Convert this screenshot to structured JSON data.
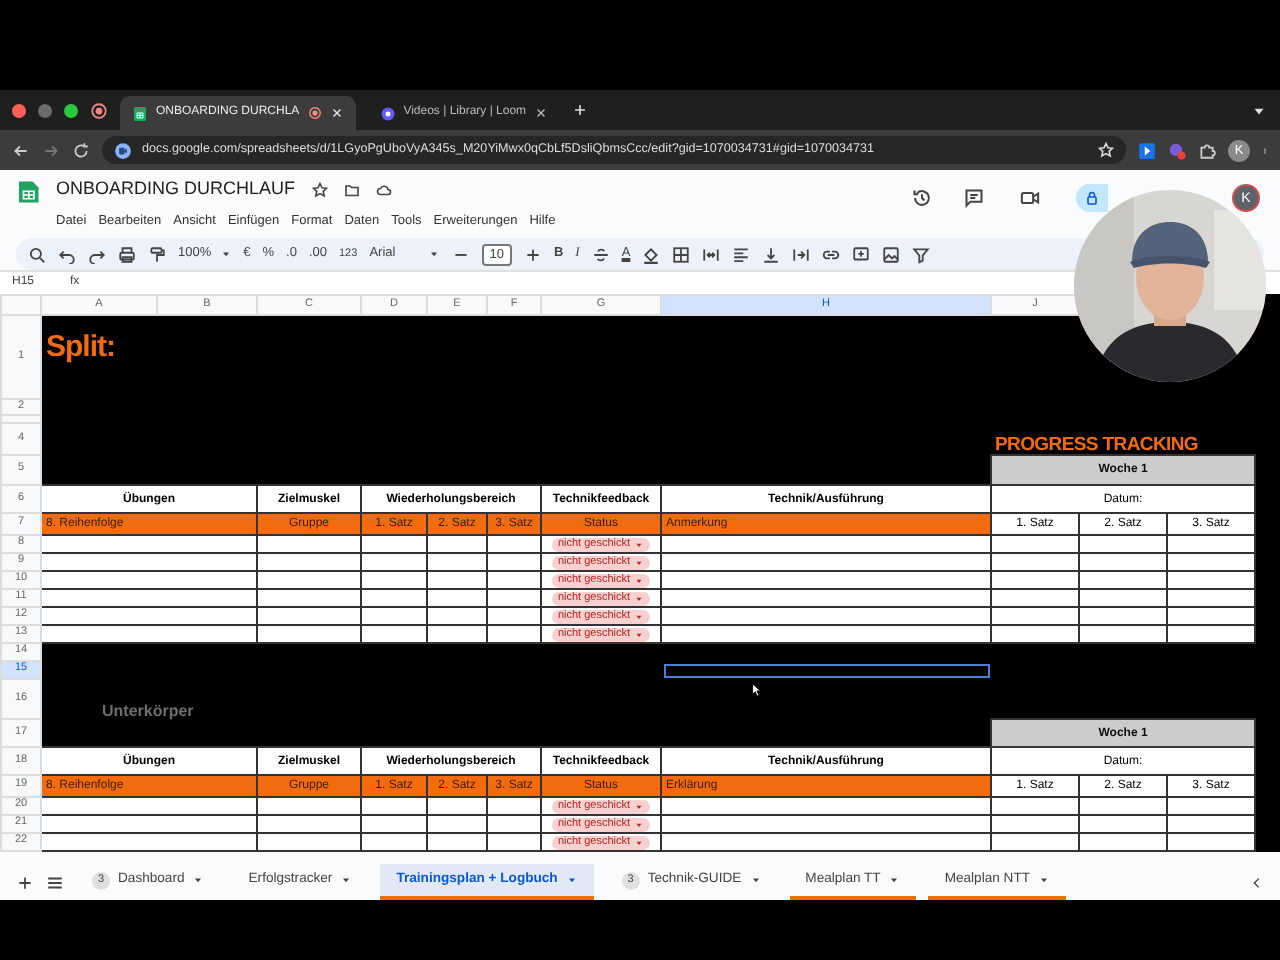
{
  "browser": {
    "tabs": [
      {
        "title": "ONBOARDING DURCHLA",
        "selected": true
      },
      {
        "title": "Videos | Library | Loom",
        "selected": false
      }
    ],
    "url": "docs.google.com/spreadsheets/d/1LGyoPgUboVyA345s_M20YiMwx0qCbLf5DsliQbmsCcc/edit?gid=1070034731#gid=1070034731",
    "profile_initial": "K"
  },
  "sheets": {
    "title": "ONBOARDING DURCHLAUF",
    "menu": [
      "Datei",
      "Bearbeiten",
      "Ansicht",
      "Einfügen",
      "Format",
      "Daten",
      "Tools",
      "Erweiterungen",
      "Hilfe"
    ],
    "avatar_initial": "K",
    "toolbar": {
      "zoom": "100%",
      "currency": "€",
      "percent": "%",
      "decrease_decimals": ".0",
      "increase_decimals": ".00",
      "number_format": "123",
      "font": "Arial",
      "font_size": "10",
      "bold": "B",
      "italic": "I",
      "text_color": "A"
    },
    "name_box": "H15",
    "formula_label": "fx"
  },
  "grid": {
    "columns": [
      {
        "letter": "A",
        "selected": false
      },
      {
        "letter": "B",
        "selected": false
      },
      {
        "letter": "C",
        "selected": false
      },
      {
        "letter": "D",
        "selected": false
      },
      {
        "letter": "E",
        "selected": false
      },
      {
        "letter": "F",
        "selected": false
      },
      {
        "letter": "G",
        "selected": false
      },
      {
        "letter": "H",
        "selected": true
      },
      {
        "letter": "J",
        "selected": false
      }
    ],
    "rows": [
      {
        "number": "1",
        "selected": false
      },
      {
        "number": "2",
        "selected": false
      },
      {
        "selected": false
      },
      {
        "number": "4",
        "selected": false
      },
      {
        "number": "5",
        "selected": false
      },
      {
        "number": "6",
        "selected": false
      },
      {
        "number": "7",
        "selected": false
      },
      {
        "number": "8",
        "selected": false
      },
      {
        "number": "9",
        "selected": false
      },
      {
        "number": "10",
        "selected": false
      },
      {
        "number": "11",
        "selected": false
      },
      {
        "number": "12",
        "selected": false
      },
      {
        "number": "13",
        "selected": false
      },
      {
        "number": "14",
        "selected": false
      },
      {
        "number": "15",
        "selected": true
      },
      {
        "number": "16",
        "selected": false
      },
      {
        "number": "17",
        "selected": false
      },
      {
        "number": "18",
        "selected": false
      },
      {
        "number": "19",
        "selected": false
      },
      {
        "number": "20",
        "selected": false
      },
      {
        "number": "21",
        "selected": false
      },
      {
        "number": "22",
        "selected": false
      }
    ],
    "split_title": "Split:",
    "progress_title": "PROGRESS TRACKING",
    "section_title": "Unterkörper",
    "blocks": [
      {
        "headers": [
          "Übungen",
          "Zielmuskel",
          "Wiederholungsbereich",
          "Technikfeedback",
          "Technik/Ausführung"
        ],
        "subheaders": [
          "8. Reihenfolge",
          "Gruppe",
          "1. Satz",
          "2. Satz",
          "3. Satz",
          "Status",
          "Anmerkung"
        ],
        "statuses": [
          "nicht geschickt",
          "nicht geschickt",
          "nicht geschickt",
          "nicht geschickt",
          "nicht geschickt",
          "nicht geschickt"
        ],
        "tracking": {
          "week": "Woche 1",
          "date": "Datum:",
          "sets": [
            "1. Satz",
            "2. Satz",
            "3. Satz"
          ]
        }
      },
      {
        "headers": [
          "Übungen",
          "Zielmuskel",
          "Wiederholungsbereich",
          "Technikfeedback",
          "Technik/Ausführung"
        ],
        "subheaders": [
          "8. Reihenfolge",
          "Gruppe",
          "1. Satz",
          "2. Satz",
          "3. Satz",
          "Status",
          "Erklärung"
        ],
        "statuses": [
          "nicht geschickt",
          "nicht geschickt",
          "nicht geschickt"
        ],
        "tracking": {
          "week": "Woche 1",
          "date": "Datum:",
          "sets": [
            "1. Satz",
            "2. Satz",
            "3. Satz"
          ]
        }
      }
    ]
  },
  "sheet_tabs": [
    {
      "label": "Dashboard",
      "badge": "3",
      "selected": false
    },
    {
      "label": "Erfolgstracker",
      "selected": false
    },
    {
      "label": "Trainingsplan + Logbuch",
      "selected": true,
      "color": "#e8710a"
    },
    {
      "label": "Technik-GUIDE",
      "badge": "3",
      "selected": false
    },
    {
      "label": "Mealplan TT",
      "selected": false,
      "color": "#e8710a"
    },
    {
      "label": "Mealplan NTT",
      "selected": false,
      "color": "#e8710a"
    }
  ]
}
